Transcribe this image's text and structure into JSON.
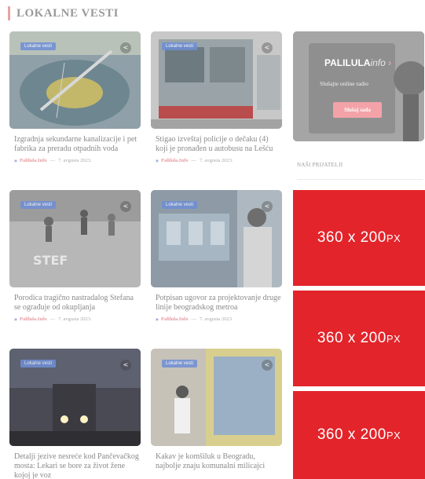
{
  "section": {
    "title": "LOKALNE VESTI"
  },
  "articles": [
    {
      "badge": "Lokalne vesti",
      "title": "Izgradnja sekundarne kanalizacije i pet fabrika za preradu otpadnih voda",
      "author": "Palilula.Info",
      "date": "7. avgusta 2023.",
      "share_icon": "share-icon"
    },
    {
      "badge": "Lokalne vesti",
      "title": "Stigao izveštaj policije o dečaku (4) koji je pronađen u autobusu na Lešću",
      "author": "Palilula.Info",
      "date": "7. avgusta 2023.",
      "share_icon": "share-icon"
    },
    {
      "badge": "Lokalne vesti",
      "title": "Porodica tragično nastradalog Stefana se ograđuje od okupljanja",
      "author": "Palilula.Info",
      "date": "7. avgusta 2023.",
      "share_icon": "share-icon"
    },
    {
      "badge": "Lokalne vesti",
      "title": "Potpisan ugovor za projektovanje druge linije beogradskog metroa",
      "author": "Palilula.Info",
      "date": "7. avgusta 2023.",
      "share_icon": "share-icon"
    },
    {
      "badge": "Lokalne vesti",
      "title": "Detalji jezive nesreće kod Pančevačkog mosta: Lekari se bore za život žene kojoj je voz",
      "author": "",
      "date": "",
      "share_icon": "share-icon"
    },
    {
      "badge": "Lokalne vesti",
      "title": "Kakav je komšiluk u Beogradu, najbolje znaju komunalni milicajci",
      "author": "",
      "date": "",
      "share_icon": "share-icon"
    }
  ],
  "meta_separator": "—",
  "radio": {
    "logo": "PALILULA",
    "logo_suffix": "info",
    "subtitle": "Slušajte online radio",
    "button": "Slušaj sada"
  },
  "friends": {
    "title": "NAŠI PRIJATELJI"
  },
  "ads": [
    {
      "main": "360 x 200",
      "unit": "PX"
    },
    {
      "main": "360 x 200",
      "unit": "PX"
    },
    {
      "main": "360 x 200",
      "unit": "PX"
    }
  ],
  "colors": {
    "accent": "#e8a3a6",
    "badge": "#6f8fd6",
    "ad": "#e3242b"
  }
}
